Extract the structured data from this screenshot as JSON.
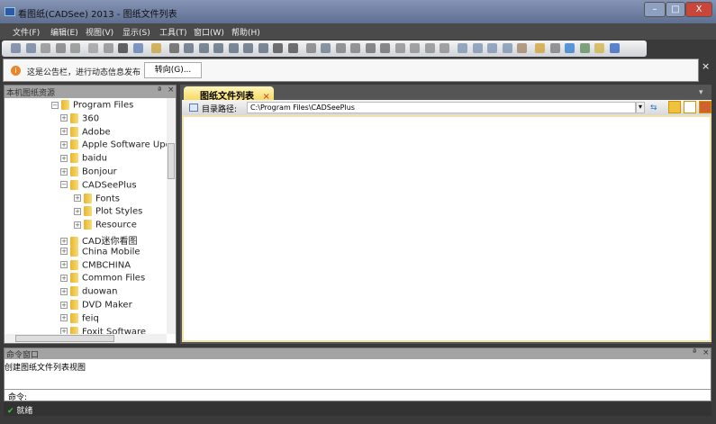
{
  "window": {
    "title": "看图纸(CADSee) 2013 - 图纸文件列表",
    "minimize": "–",
    "maximize": "□",
    "close": "X"
  },
  "menu": [
    "文件(F)",
    "编辑(E)",
    "视图(V)",
    "显示(S)",
    "工具(T)",
    "窗口(W)",
    "帮助(H)"
  ],
  "notice": {
    "icon": "i",
    "text": "这是公告栏，进行动态信息发布",
    "goto_label": "转向(G)...",
    "close": "×"
  },
  "left_panel": {
    "title": "本机图纸资源",
    "pin": "ª",
    "close": "×",
    "tree": [
      {
        "label": "Program Files",
        "level": 0,
        "exp": "−"
      },
      {
        "label": "360",
        "level": 1,
        "exp": "+"
      },
      {
        "label": "Adobe",
        "level": 1,
        "exp": "+"
      },
      {
        "label": "Apple Software Upda",
        "level": 1,
        "exp": "+"
      },
      {
        "label": "baidu",
        "level": 1,
        "exp": "+"
      },
      {
        "label": "Bonjour",
        "level": 1,
        "exp": "+"
      },
      {
        "label": "CADSeePlus",
        "level": 1,
        "exp": "−"
      },
      {
        "label": "Fonts",
        "level": 2,
        "exp": "+"
      },
      {
        "label": "Plot Styles",
        "level": 2,
        "exp": "+"
      },
      {
        "label": "Resource",
        "level": 2,
        "exp": "+"
      },
      {
        "label": "CAD迷你看图",
        "level": 1,
        "exp": "+"
      },
      {
        "label": "China Mobile",
        "level": 1,
        "exp": "+"
      },
      {
        "label": "CMBCHINA",
        "level": 1,
        "exp": "+"
      },
      {
        "label": "Common Files",
        "level": 1,
        "exp": "+"
      },
      {
        "label": "duowan",
        "level": 1,
        "exp": "+"
      },
      {
        "label": "DVD Maker",
        "level": 1,
        "exp": "+"
      },
      {
        "label": "feiq",
        "level": 1,
        "exp": "+"
      },
      {
        "label": "Foxit Software",
        "level": 1,
        "exp": "+"
      }
    ]
  },
  "main": {
    "tab_label": "图纸文件列表",
    "tab_close": "×",
    "path_label": "目录路径:",
    "path_value": "C:\\Program Files\\CADSeePlus",
    "dropdown": "▾"
  },
  "command": {
    "title": "命令窗口",
    "pin": "ª",
    "close": "×",
    "output": "创建图纸文件列表视图",
    "prompt": "命令:"
  },
  "status": {
    "icon": "✔",
    "text": "就绪"
  },
  "toolbar_icon_colors": [
    "#6a7a9a",
    "#6a7a9a",
    "#8a8a8a",
    "#777",
    "#888",
    "#999",
    "#888",
    "#333",
    "#5a7ab0",
    "#c8a030",
    "#555",
    "#567",
    "#567",
    "#567",
    "#567",
    "#567",
    "#567",
    "#444",
    "#444",
    "#777",
    "#678",
    "#777",
    "#777",
    "#666",
    "#666",
    "#888",
    "#888",
    "#888",
    "#888",
    "#7890b0",
    "#7890b0",
    "#7890b0",
    "#7890b0",
    "#a08060",
    "#d0a030",
    "#777",
    "#2a7ad0",
    "#5a8a5a",
    "#d0b040",
    "#2a60c0"
  ]
}
